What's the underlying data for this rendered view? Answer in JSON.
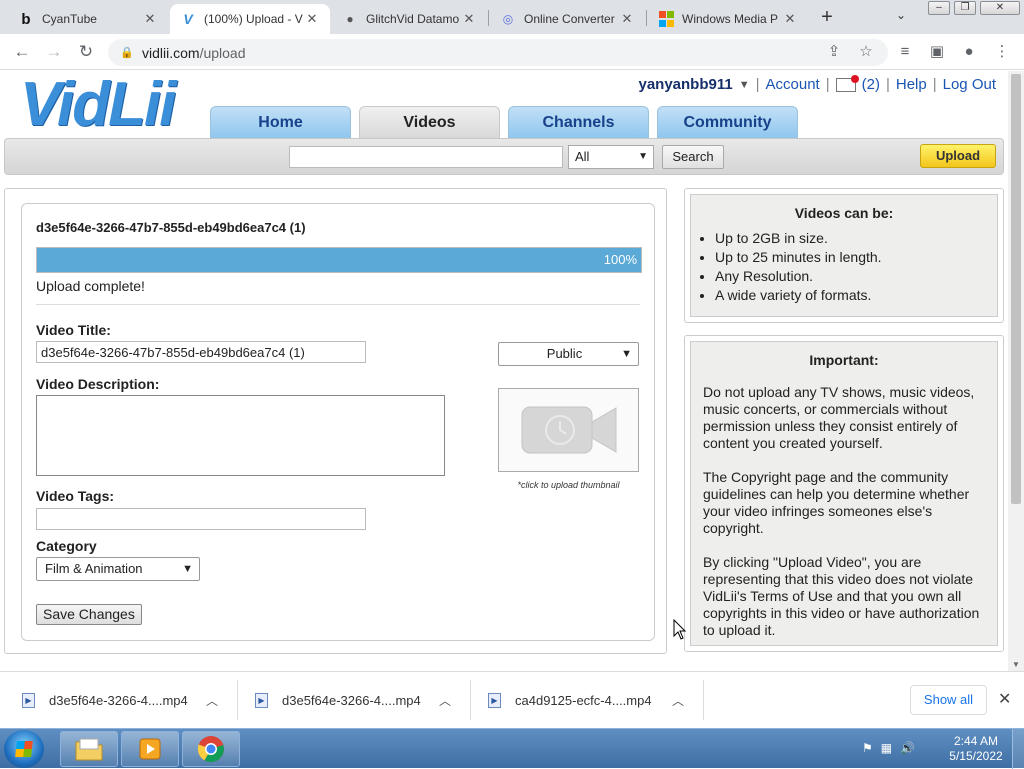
{
  "browser": {
    "tabs": [
      {
        "title": "CyanTube",
        "icon": "cyantube-favicon",
        "glyph": "b"
      },
      {
        "title": "(100%) Upload - V",
        "icon": "vidlii-favicon",
        "glyph": "V"
      },
      {
        "title": "GlitchVid Datamo",
        "icon": "globe-favicon",
        "glyph": "●"
      },
      {
        "title": "Online Converter",
        "icon": "converter-favicon",
        "glyph": "◎"
      },
      {
        "title": "Windows Media P",
        "icon": "windows-favicon",
        "glyph": "▦"
      }
    ],
    "url_host": "vidlii.com",
    "url_path": "/upload"
  },
  "site": {
    "logo": "VidLii",
    "user": {
      "username": "yanyanbb911",
      "account": "Account",
      "messages": "(2)",
      "help": "Help",
      "logout": "Log Out"
    },
    "nav": [
      "Home",
      "Videos",
      "Channels",
      "Community"
    ],
    "search": {
      "value": "",
      "scope": "All",
      "button": "Search",
      "upload": "Upload"
    }
  },
  "upload": {
    "filename": "d3e5f64e-3266-47b7-855d-eb49bd6ea7c4 (1)",
    "progress_text": "100%",
    "progress": 1.0,
    "status": "Upload complete!",
    "title_label": "Video Title:",
    "title_value": "d3e5f64e-3266-47b7-855d-eb49bd6ea7c4 (1)",
    "privacy": "Public",
    "description_label": "Video Description:",
    "thumbnail_caption": "*click to upload thumbnail",
    "tags_label": "Video Tags:",
    "category_label": "Category",
    "category": "Film & Animation",
    "save": "Save Changes"
  },
  "sidebar": {
    "videos_title": "Videos can be:",
    "videos_items": [
      "Up to 2GB in size.",
      "Up to 25 minutes in length.",
      "Any Resolution.",
      "A wide variety of formats."
    ],
    "important_title": "Important:",
    "important_paragraphs": [
      "Do not upload any TV shows, music videos, music concerts, or commercials without permission unless they consist entirely of content you created yourself.",
      "The Copyright page and the community guidelines can help you determine whether your video infringes someones else's copyright.",
      "By clicking \"Upload Video\", you are representing that this video does not violate VidLii's Terms of Use and that you own all copyrights in this video or have authorization to upload it."
    ]
  },
  "downloads": {
    "items": [
      "d3e5f64e-3266-4....mp4",
      "d3e5f64e-3266-4....mp4",
      "ca4d9125-ecfc-4....mp4"
    ],
    "show_all": "Show all"
  },
  "taskbar": {
    "time": "2:44 AM",
    "date": "5/15/2022"
  }
}
